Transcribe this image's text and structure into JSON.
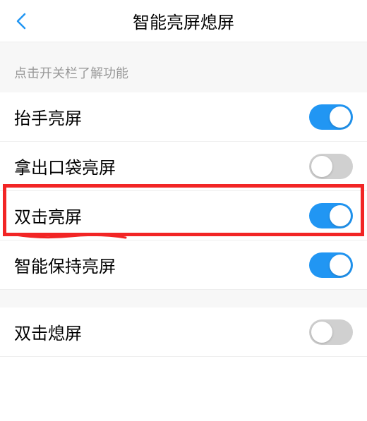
{
  "header": {
    "title": "智能亮屏熄屏"
  },
  "hint": "点击开关栏了解功能",
  "rows": [
    {
      "label": "抬手亮屏",
      "on": true
    },
    {
      "label": "拿出口袋亮屏",
      "on": false
    },
    {
      "label": "双击亮屏",
      "on": true
    },
    {
      "label": "智能保持亮屏",
      "on": true
    },
    {
      "label": "双击熄屏",
      "on": false
    }
  ],
  "colors": {
    "accent": "#2196f3",
    "highlight": "#f22525"
  }
}
